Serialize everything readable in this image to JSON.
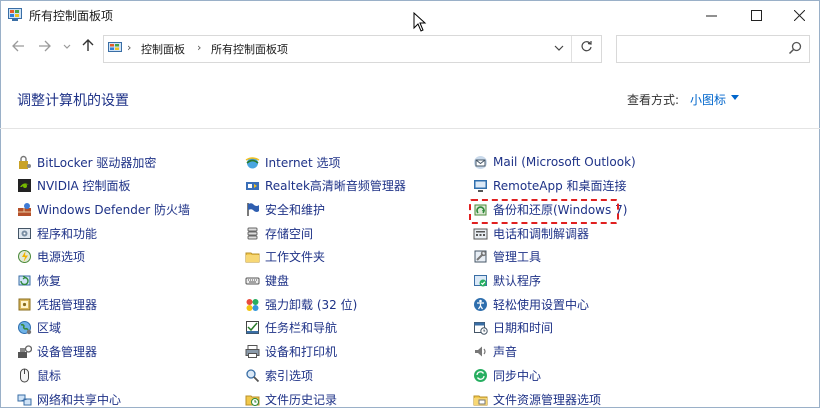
{
  "window": {
    "title": "所有控制面板项"
  },
  "address": {
    "crumbs": [
      "控制面板",
      "所有控制面板项"
    ]
  },
  "search": {
    "placeholder": ""
  },
  "header": {
    "title": "调整计算机的设置",
    "view_by_label": "查看方式:",
    "view_by_value": "小图标"
  },
  "columns": [
    {
      "items": [
        {
          "label": "BitLocker 驱动器加密",
          "icon": "bitlocker-icon"
        },
        {
          "label": "NVIDIA 控制面板",
          "icon": "nvidia-icon"
        },
        {
          "label": "Windows Defender 防火墙",
          "icon": "firewall-icon"
        },
        {
          "label": "程序和功能",
          "icon": "programs-icon"
        },
        {
          "label": "电源选项",
          "icon": "power-icon"
        },
        {
          "label": "恢复",
          "icon": "recovery-icon"
        },
        {
          "label": "凭据管理器",
          "icon": "credential-icon"
        },
        {
          "label": "区域",
          "icon": "region-icon"
        },
        {
          "label": "设备管理器",
          "icon": "device-manager-icon"
        },
        {
          "label": "鼠标",
          "icon": "mouse-icon"
        },
        {
          "label": "网络和共享中心",
          "icon": "network-icon"
        }
      ]
    },
    {
      "items": [
        {
          "label": "Internet 选项",
          "icon": "internet-icon"
        },
        {
          "label": "Realtek高清晰音频管理器",
          "icon": "realtek-icon"
        },
        {
          "label": "安全和维护",
          "icon": "flag-icon"
        },
        {
          "label": "存储空间",
          "icon": "storage-icon"
        },
        {
          "label": "工作文件夹",
          "icon": "folder-icon"
        },
        {
          "label": "键盘",
          "icon": "keyboard-icon"
        },
        {
          "label": "强力卸载 (32 位)",
          "icon": "uninstall-icon"
        },
        {
          "label": "任务栏和导航",
          "icon": "taskbar-icon"
        },
        {
          "label": "设备和打印机",
          "icon": "printer-icon"
        },
        {
          "label": "索引选项",
          "icon": "index-icon"
        },
        {
          "label": "文件历史记录",
          "icon": "history-icon"
        }
      ]
    },
    {
      "items": [
        {
          "label": "Mail (Microsoft Outlook)",
          "icon": "mail-icon"
        },
        {
          "label": "RemoteApp 和桌面连接",
          "icon": "remoteapp-icon"
        },
        {
          "label": "备份和还原(Windows 7)",
          "icon": "backup-icon"
        },
        {
          "label": "电话和调制解调器",
          "icon": "phone-icon"
        },
        {
          "label": "管理工具",
          "icon": "admin-tools-icon"
        },
        {
          "label": "默认程序",
          "icon": "default-programs-icon"
        },
        {
          "label": "轻松使用设置中心",
          "icon": "ease-access-icon"
        },
        {
          "label": "日期和时间",
          "icon": "datetime-icon"
        },
        {
          "label": "声音",
          "icon": "sound-icon"
        },
        {
          "label": "同步中心",
          "icon": "sync-icon"
        },
        {
          "label": "文件资源管理器选项",
          "icon": "explorer-options-icon"
        }
      ]
    }
  ],
  "colors": {
    "link": "#1e3287",
    "accent": "#0066cc",
    "highlight": "#e02020"
  }
}
